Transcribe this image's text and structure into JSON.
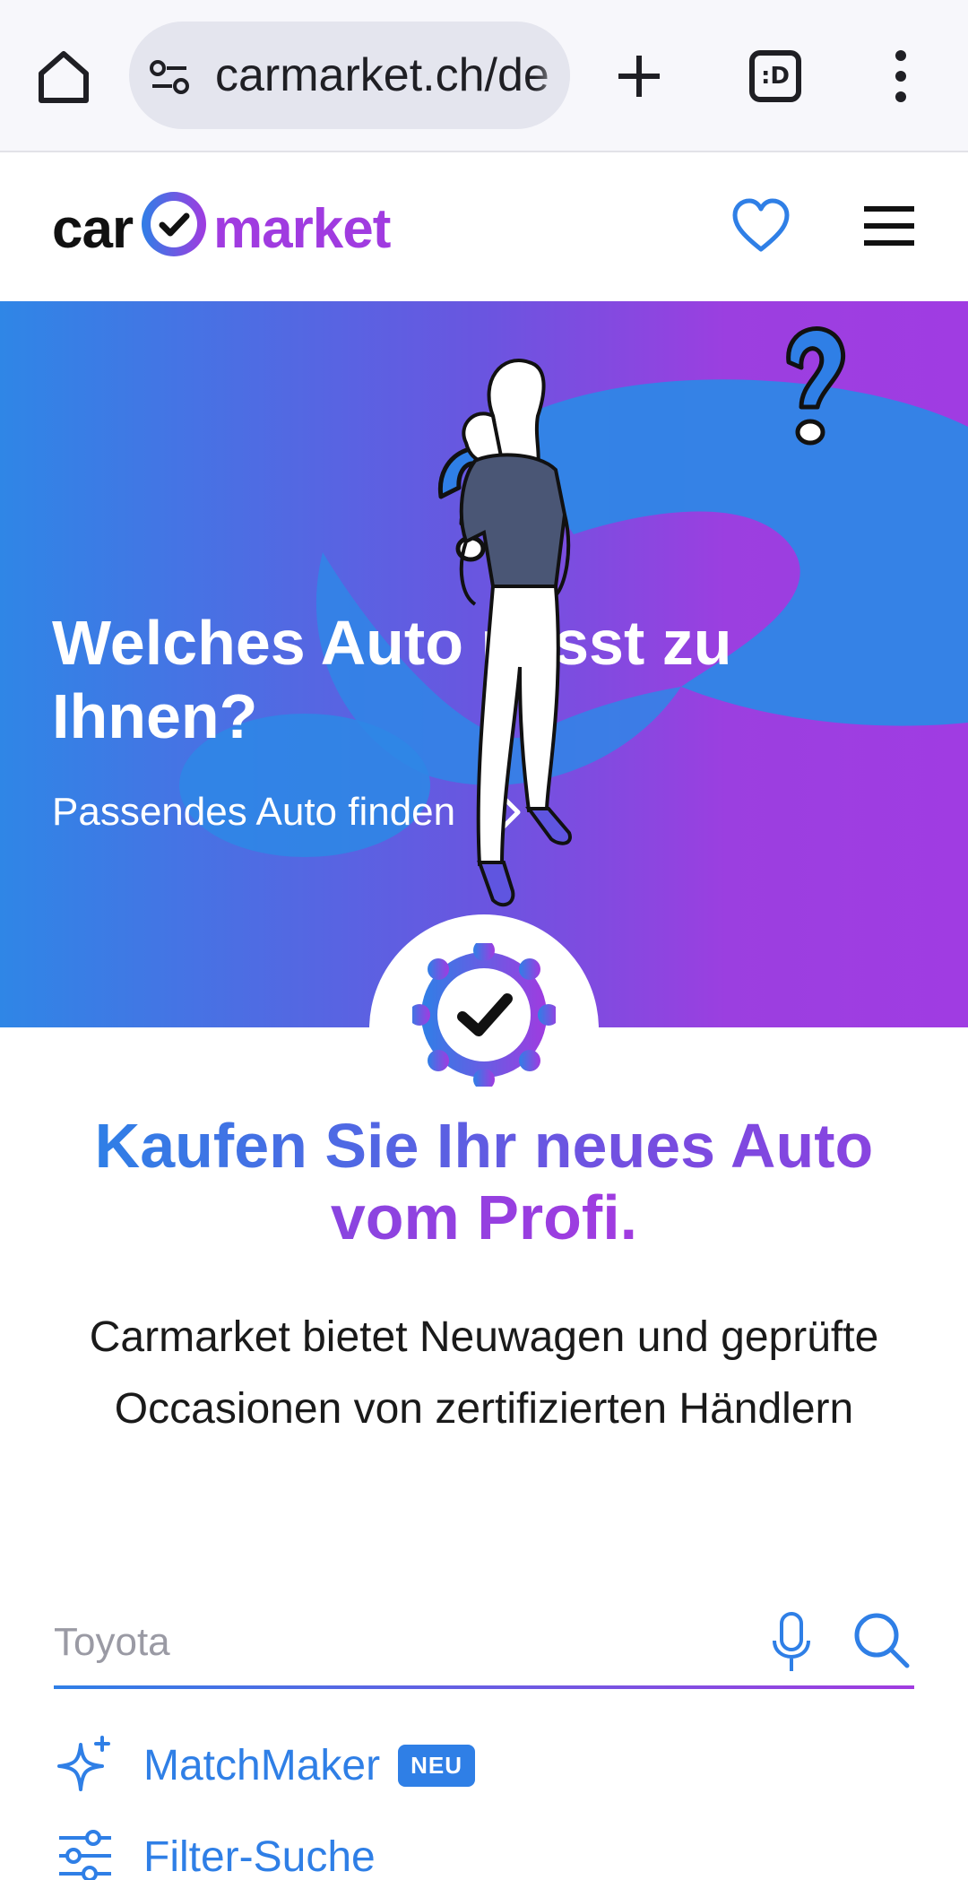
{
  "browser": {
    "url": "carmarket.ch/de",
    "tab_count_label": ":D"
  },
  "header": {
    "logo_left": "car",
    "logo_right": "market"
  },
  "hero": {
    "title": "Welches Auto passt zu Ihnen?",
    "link_label": "Passendes Auto finden"
  },
  "intro": {
    "headline": "Kaufen Sie Ihr neues Auto vom Profi.",
    "description": "Carmarket bietet Neuwagen und geprüfte Occasionen von zertifizierten Händlern"
  },
  "search": {
    "placeholder": "Toyota",
    "value": ""
  },
  "links": {
    "matchmaker": {
      "label": "MatchMaker",
      "badge": "NEU",
      "icon": "sparkle-icon"
    },
    "filter": {
      "label": "Filter-Suche",
      "icon": "sliders-icon"
    }
  },
  "colors": {
    "brand_blue": "#2f7fe6",
    "brand_purple": "#a03be0"
  }
}
